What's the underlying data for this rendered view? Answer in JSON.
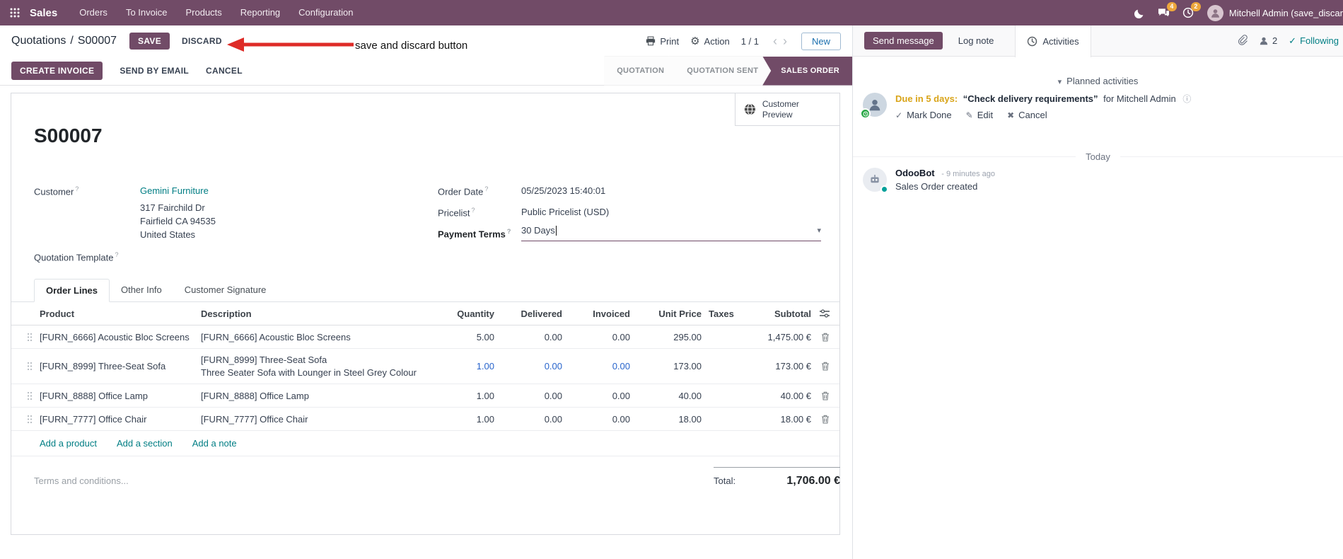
{
  "colors": {
    "accent": "#714B67",
    "link": "#017e84",
    "edited_value": "#2965cc",
    "annotation_red": "#de2b27",
    "due_warning": "#d9a419",
    "active_state_bg": "#714B67",
    "following_teal": "#017e84"
  },
  "topbar": {
    "app": "Sales",
    "menus": [
      "Orders",
      "To Invoice",
      "Products",
      "Reporting",
      "Configuration"
    ],
    "chat_badge": "4",
    "clock_badge": "2",
    "user": "Mitchell Admin (save_discar"
  },
  "breadcrumb": {
    "parent": "Quotations",
    "sep": "/",
    "current": "S00007",
    "save": "SAVE",
    "discard": "DISCARD"
  },
  "annotation": {
    "text": "save and discard button"
  },
  "controls": {
    "print": "Print",
    "action": "Action",
    "pager": "1 / 1",
    "prev": "‹",
    "next": "›",
    "new": "New"
  },
  "statusbar": {
    "create_invoice": "CREATE INVOICE",
    "send_by_email": "SEND BY EMAIL",
    "cancel": "CANCEL",
    "states": [
      {
        "label": "QUOTATION"
      },
      {
        "label": "QUOTATION SENT"
      },
      {
        "label": "SALES ORDER"
      }
    ]
  },
  "sheet": {
    "preview": "Customer Preview",
    "title": "S00007",
    "help_mark": "?",
    "customer": {
      "label": "Customer",
      "value": "Gemini Furniture",
      "address1": "317 Fairchild Dr",
      "address2": "Fairfield CA 94535",
      "address3": "United States"
    },
    "quotation_template": {
      "label": "Quotation Template"
    },
    "order_date": {
      "label": "Order Date",
      "value": "05/25/2023 15:40:01"
    },
    "pricelist": {
      "label": "Pricelist",
      "value": "Public Pricelist (USD)"
    },
    "payment_terms": {
      "label": "Payment Terms",
      "value": "30 Days",
      "caret": "▾"
    },
    "tabs": {
      "order_lines": "Order Lines",
      "other_info": "Other Info",
      "customer_signature": "Customer Signature"
    },
    "table": {
      "headers": {
        "product": "Product",
        "description": "Description",
        "quantity": "Quantity",
        "delivered": "Delivered",
        "invoiced": "Invoiced",
        "unit_price": "Unit Price",
        "taxes": "Taxes",
        "subtotal": "Subtotal"
      },
      "rows": [
        {
          "product": "[FURN_6666] Acoustic Bloc Screens",
          "description": "[FURN_6666] Acoustic Bloc Screens",
          "quantity": "5.00",
          "delivered": "0.00",
          "invoiced": "0.00",
          "unit_price": "295.00",
          "subtotal": "1,475.00 €"
        },
        {
          "product": "[FURN_8999] Three-Seat Sofa",
          "description": "[FURN_8999] Three-Seat Sofa",
          "description2": "Three Seater Sofa with Lounger in Steel Grey Colour",
          "quantity": "1.00",
          "delivered": "0.00",
          "invoiced": "0.00",
          "unit_price": "173.00",
          "subtotal": "173.00 €"
        },
        {
          "product": "[FURN_8888] Office Lamp",
          "description": "[FURN_8888] Office Lamp",
          "quantity": "1.00",
          "delivered": "0.00",
          "invoiced": "0.00",
          "unit_price": "40.00",
          "subtotal": "40.00 €"
        },
        {
          "product": "[FURN_7777] Office Chair",
          "description": "[FURN_7777] Office Chair",
          "quantity": "1.00",
          "delivered": "0.00",
          "invoiced": "0.00",
          "unit_price": "18.00",
          "subtotal": "18.00 €"
        }
      ],
      "links": {
        "add_product": "Add a product",
        "add_section": "Add a section",
        "add_note": "Add a note"
      }
    },
    "terms_placeholder": "Terms and conditions...",
    "total": {
      "label": "Total:",
      "value": "1,706.00 €"
    }
  },
  "chatter": {
    "send_message": "Send message",
    "log_note": "Log note",
    "activities": "Activities",
    "followers_count": "2",
    "following": "Following",
    "planned": "Planned activities",
    "planned_caret": "▾",
    "activity": {
      "due": "Due in 5 days:",
      "summary": "“Check delivery requirements”",
      "for_user": "for Mitchell Admin",
      "info": "ⓘ",
      "mark_done": "Mark Done",
      "edit": "Edit",
      "cancel": "Cancel",
      "mark_done_icon": "✓",
      "edit_icon": "✎",
      "cancel_icon": "✖"
    },
    "today": "Today",
    "message": {
      "author": "OdooBot",
      "time": "- 9 minutes ago",
      "body": "Sales Order created"
    }
  }
}
